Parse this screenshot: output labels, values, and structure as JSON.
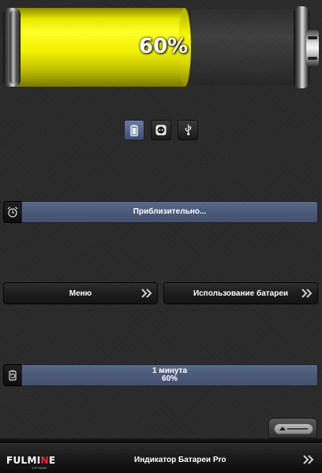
{
  "battery": {
    "level": 0.6,
    "percent_label": "60%",
    "fill_color": "#f5f500"
  },
  "power_sources": [
    {
      "icon": "battery-icon",
      "active": true
    },
    {
      "icon": "power-outlet-icon",
      "active": false
    },
    {
      "icon": "usb-icon",
      "active": false
    }
  ],
  "estimate_row": {
    "icon": "alarm-clock-icon",
    "text": "Приблизительно..."
  },
  "menu": {
    "menu_label": "Меню",
    "battery_usage_label": "Использование батареи"
  },
  "status_row": {
    "icon": "battery-refresh-icon",
    "line1": "1 минута",
    "line2": "60%"
  },
  "footer": {
    "logo_main": "FULMI",
    "logo_accent": "N",
    "logo_end": "E",
    "logo_sub": "SOFTWARE",
    "title": "Индикатор Батареи Pro"
  },
  "colors": {
    "accent_bar": "#4d5a79",
    "active_button": "#5b6e99",
    "logo_red": "#e8262b"
  }
}
